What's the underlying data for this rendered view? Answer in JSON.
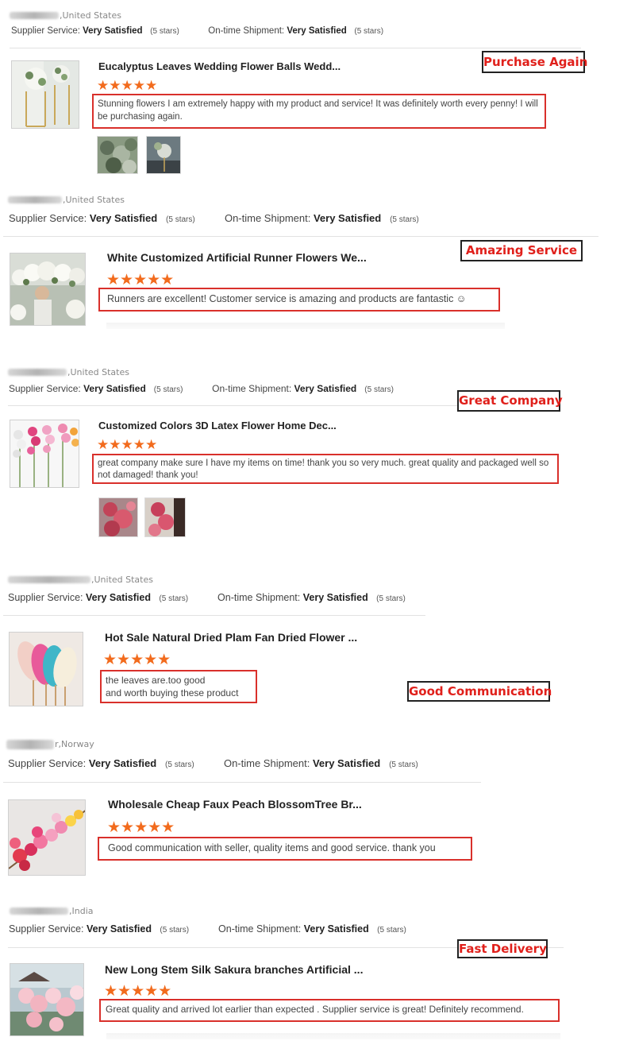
{
  "labels": {
    "supplier_service": "Supplier Service:",
    "ontime_shipment": "On-time Shipment:"
  },
  "colors": {
    "accent": "#d9302b",
    "star": "#f26b1d",
    "tag_text": "#e0201b"
  },
  "reviews": [
    {
      "country": ",United States",
      "supplier_value": "Very Satisfied",
      "supplier_stars": "(5 stars)",
      "shipment_value": "Very Satisfied",
      "shipment_stars": "(5 stars)",
      "product_title": "Eucalyptus Leaves Wedding Flower Balls Wedd...",
      "rating_stars": "★★★★★",
      "comment": "Stunning flowers I am extremely happy with my product and service! It was definitely worth every penny! I will be purchasing again.",
      "tag": "Purchase Again"
    },
    {
      "country": ",United States",
      "supplier_value": "Very Satisfied",
      "supplier_stars": "(5 stars)",
      "shipment_value": "Very Satisfied",
      "shipment_stars": "(5 stars)",
      "product_title": "White Customized Artificial Runner Flowers We...",
      "rating_stars": "★★★★★",
      "comment": "Runners are excellent! Customer service is amazing and products are fantastic ☺",
      "tag": "Amazing Service"
    },
    {
      "country": ",United States",
      "supplier_value": "Very Satisfied",
      "supplier_stars": "(5 stars)",
      "shipment_value": "Very Satisfied",
      "shipment_stars": "(5 stars)",
      "product_title": "Customized Colors 3D Latex Flower Home Dec...",
      "rating_stars": "★★★★★",
      "comment": "great company make sure I have my items on time!  thank you so very much.  great quality and packaged well so not damaged!  thank you!",
      "tag": "Great Company"
    },
    {
      "country": ",United States",
      "supplier_value": "Very Satisfied",
      "supplier_stars": "(5 stars)",
      "shipment_value": "Very Satisfied",
      "shipment_stars": "(5 stars)",
      "product_title": "Hot Sale Natural Dried Plam Fan Dried Flower ...",
      "rating_stars": "★★★★★",
      "comment_line1": "the leaves are.too good",
      "comment_line2": "and worth buying these product",
      "tag": "Good Communication"
    },
    {
      "country": "r,Norway",
      "supplier_value": "Very Satisfied",
      "supplier_stars": "(5 stars)",
      "shipment_value": "Very Satisfied",
      "shipment_stars": "(5 stars)",
      "product_title": "Wholesale Cheap Faux Peach BlossomTree Br...",
      "rating_stars": "★★★★★",
      "comment": "Good communication with seller, quality items and good service. thank you"
    },
    {
      "country": ",India",
      "supplier_value": "Very Satisfied",
      "supplier_stars": "(5 stars)",
      "shipment_value": "Very Satisfied",
      "shipment_stars": "(5 stars)",
      "product_title": "New Long Stem Silk Sakura branches Artificial ...",
      "rating_stars": "★★★★★",
      "comment": "Great quality and arrived lot earlier than expected .  Supplier service is great! Definitely recommend.",
      "tag": "Fast Delivery"
    }
  ]
}
